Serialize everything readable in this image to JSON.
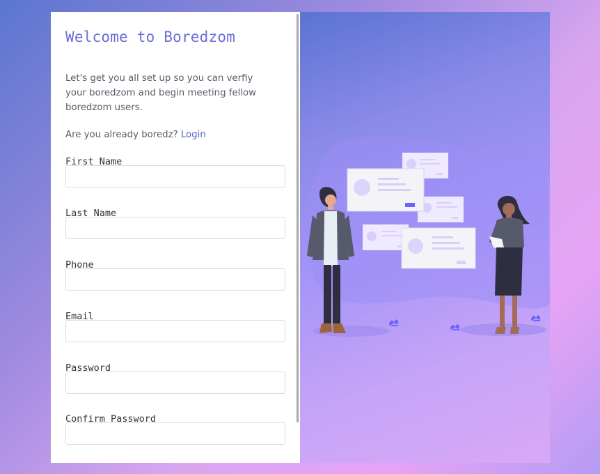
{
  "form": {
    "title": "Welcome to Boredzom",
    "intro": "Let's get you all set up so you can verfiy your boredzom and begin meeting fellow boredzom users.",
    "already_prefix": "Are you already boredz?",
    "login_link": "Login",
    "fields": [
      {
        "label": "First Name",
        "value": "",
        "placeholder": ""
      },
      {
        "label": "Last Name",
        "value": "",
        "placeholder": ""
      },
      {
        "label": "Phone",
        "value": "",
        "placeholder": ""
      },
      {
        "label": "Email",
        "value": "",
        "placeholder": ""
      },
      {
        "label": "Password",
        "value": "",
        "placeholder": ""
      },
      {
        "label": "Confirm Password",
        "value": "",
        "placeholder": ""
      }
    ]
  },
  "illustration": {
    "name": "people-networking-illustration"
  },
  "colors": {
    "title": "#6a6fd6",
    "link": "#5a63c8",
    "accent": "#6c63ff"
  }
}
